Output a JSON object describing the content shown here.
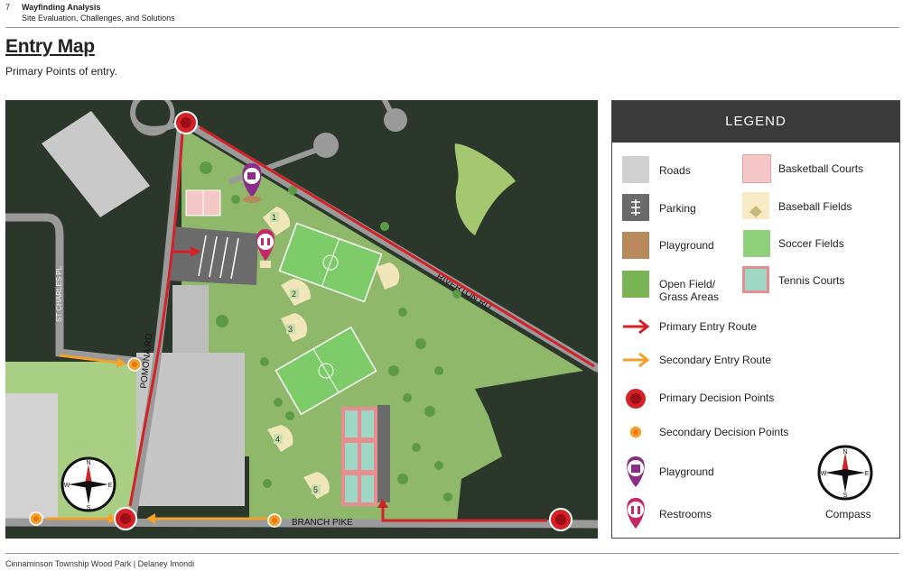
{
  "header": {
    "page_number": "7",
    "title": "Wayfinding Analysis",
    "subtitle": "Site Evaluation, Challenges, and Solutions"
  },
  "page": {
    "heading": "Entry Map",
    "subheading": "Primary Points of entry."
  },
  "map": {
    "road_labels": {
      "pomona": "POMONA RD",
      "riverton": "RIVERTON RD",
      "st_charles": "ST CHARLES PL",
      "branch": "BRANCH PIKE"
    },
    "field_numbers": [
      "1",
      "2",
      "3",
      "4",
      "5"
    ],
    "compass": {
      "n": "N",
      "s": "S",
      "e": "E",
      "w": "W"
    }
  },
  "legend": {
    "title": "LEGEND",
    "items": {
      "roads": "Roads",
      "parking": "Parking",
      "playground": "Playground",
      "open_field_1": "Open Field/",
      "open_field_2": "Grass Areas",
      "basketball": "Basketball Courts",
      "baseball": "Baseball Fields",
      "soccer": "Soccer Fields",
      "tennis": "Tennis Courts",
      "primary_route": "Primary Entry Route",
      "secondary_route": "Secondary Entry Route",
      "primary_points": "Primary Decision Points",
      "secondary_points": "Secondary Decision Points",
      "playground_marker": "Playground",
      "restrooms_marker": "Restrooms",
      "compass": "Compass"
    },
    "compass": {
      "n": "N",
      "s": "S",
      "e": "E",
      "w": "W"
    }
  },
  "colors": {
    "map_background": "#2b372b",
    "park_green": "#8fb86a",
    "road_gray": "#9a9a9a",
    "primary_red": "#d42027",
    "secondary_orange": "#f5a02a",
    "playground_purple": "#8b2d8b",
    "restroom_pink": "#c4286a"
  },
  "footer": {
    "text": "Cinnaminson Township Wood Park | Delaney Imondi"
  }
}
